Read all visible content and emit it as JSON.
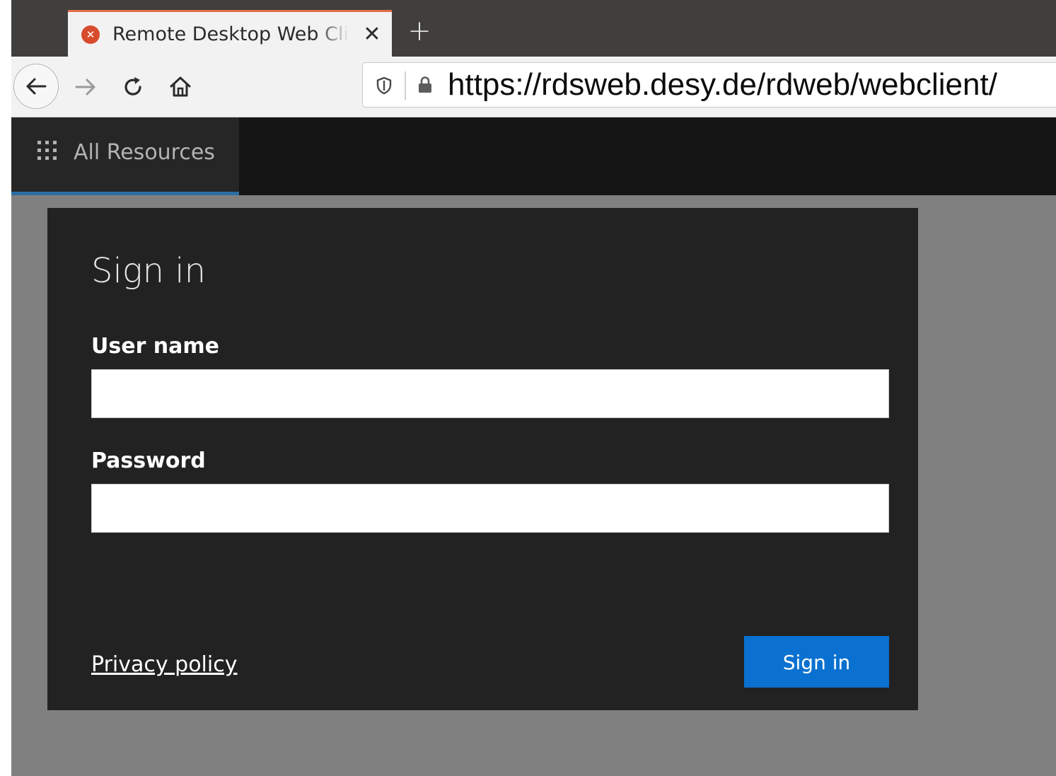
{
  "browser": {
    "tab": {
      "title": "Remote Desktop Web Client",
      "favicon": "remote-desktop-favicon",
      "close_glyph": "✕"
    },
    "new_tab_glyph": "+",
    "toolbar": {
      "back_icon": "back-arrow-icon",
      "forward_icon": "forward-arrow-icon",
      "reload_icon": "reload-icon",
      "home_icon": "home-icon",
      "shield_icon": "tracking-protection-shield-icon",
      "lock_icon": "lock-icon"
    },
    "url": "https://rdsweb.desy.de/rdweb/webclient/"
  },
  "app": {
    "nav": {
      "all_resources_label": "All Resources",
      "grid_icon": "apps-grid-icon"
    },
    "signin_form": {
      "title": "Sign in",
      "username_label": "User name",
      "username_value": "",
      "password_label": "Password",
      "password_value": "",
      "privacy_link": "Privacy policy",
      "submit_label": "Sign in"
    }
  },
  "colors": {
    "tab_accent": "#e66b4a",
    "tabstrip_bg": "#403f3d",
    "app_bar_bg": "#151515",
    "nav_active_underline": "#2b6ea4",
    "card_bg": "#222222",
    "page_bg": "#808080",
    "primary_button": "#0a71d0"
  }
}
